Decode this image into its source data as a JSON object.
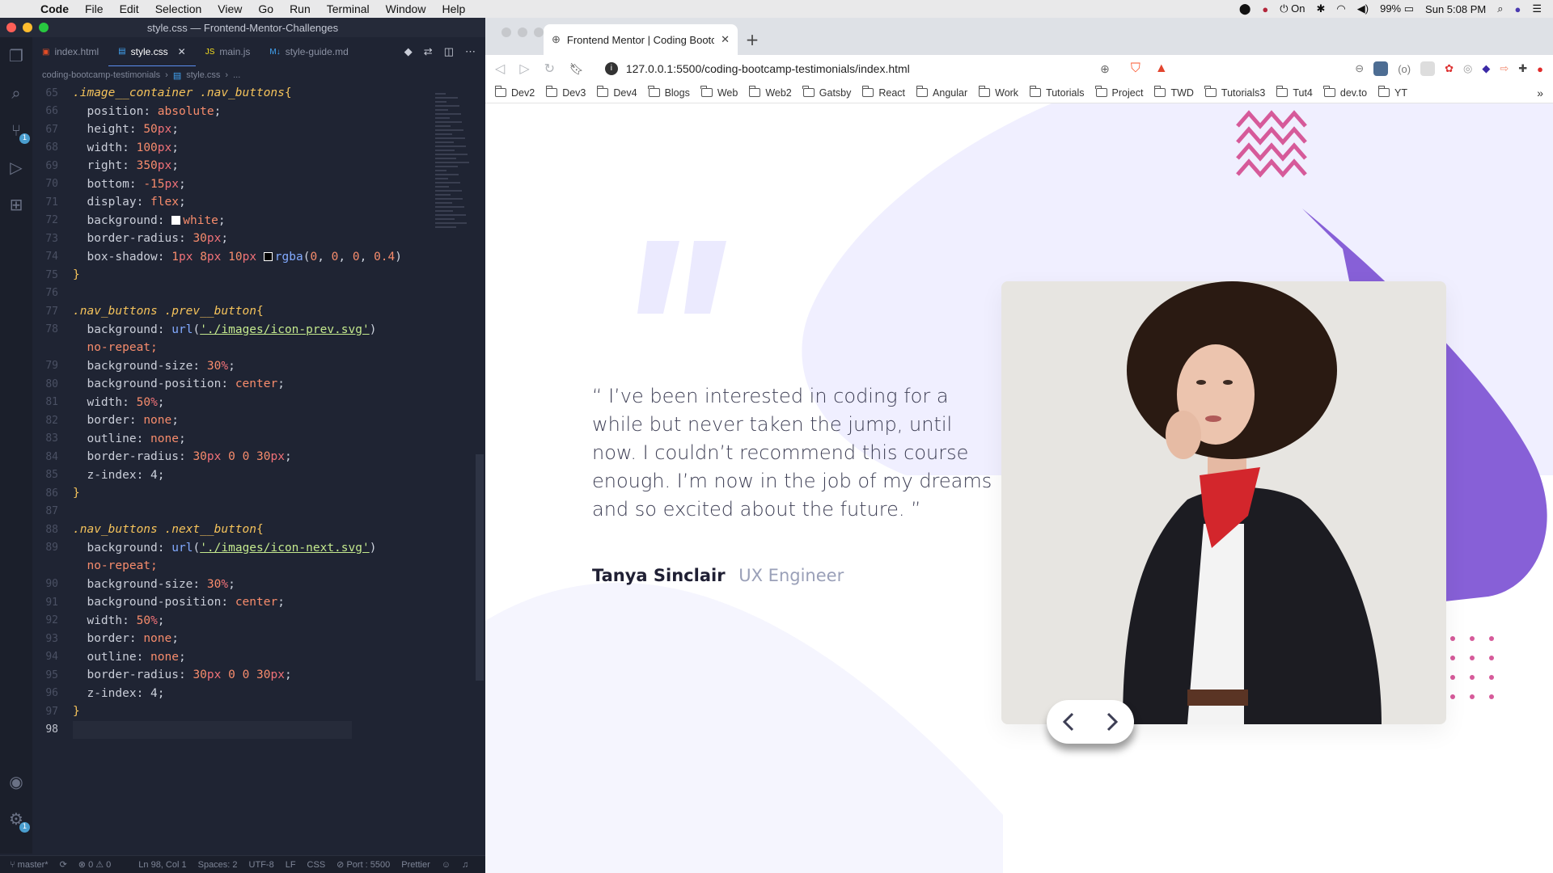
{
  "menubar": {
    "apple": "",
    "app": "Code",
    "items": [
      "File",
      "Edit",
      "Selection",
      "View",
      "Go",
      "Run",
      "Terminal",
      "Window",
      "Help"
    ],
    "status": {
      "vpn_label": "On",
      "battery": "99%",
      "clock": "Sun 5:08 PM"
    }
  },
  "vscode": {
    "title": "style.css — Frontend-Mentor-Challenges",
    "tabs": [
      {
        "label": "index.html",
        "icon": "html-file-icon",
        "active": false
      },
      {
        "label": "style.css",
        "icon": "css-file-icon",
        "active": true
      },
      {
        "label": "main.js",
        "icon": "js-file-icon",
        "active": false
      },
      {
        "label": "style-guide.md",
        "icon": "markdown-file-icon",
        "active": false
      }
    ],
    "breadcrumb": [
      "coding-bootcamp-testimonials",
      "style.css",
      "..."
    ],
    "activity_badges": {
      "source_control": "1",
      "settings": "1"
    },
    "code_lines": [
      {
        "n": "65",
        "t": ".image__container .nav_buttons{"
      },
      {
        "n": "66",
        "t": "  position: absolute;"
      },
      {
        "n": "67",
        "t": "  height: 50px;"
      },
      {
        "n": "68",
        "t": "  width: 100px;"
      },
      {
        "n": "69",
        "t": "  right: 350px;"
      },
      {
        "n": "70",
        "t": "  bottom: -15px;"
      },
      {
        "n": "71",
        "t": "  display: flex;"
      },
      {
        "n": "72",
        "t": "  background: white;"
      },
      {
        "n": "73",
        "t": "  border-radius: 30px;"
      },
      {
        "n": "74",
        "t": "  box-shadow: 1px 8px 10px rgba(0, 0, 0, 0.4)"
      },
      {
        "n": "75",
        "t": "}"
      },
      {
        "n": "76",
        "t": ""
      },
      {
        "n": "77",
        "t": ".nav_buttons .prev__button{"
      },
      {
        "n": "78",
        "t": "  background: url('./images/icon-prev.svg')"
      },
      {
        "n": "",
        "t": "  no-repeat;"
      },
      {
        "n": "79",
        "t": "  background-size: 30%;"
      },
      {
        "n": "80",
        "t": "  background-position: center;"
      },
      {
        "n": "81",
        "t": "  width: 50%;"
      },
      {
        "n": "82",
        "t": "  border: none;"
      },
      {
        "n": "83",
        "t": "  outline: none;"
      },
      {
        "n": "84",
        "t": "  border-radius: 30px 0 0 30px;"
      },
      {
        "n": "85",
        "t": "  z-index: 4;"
      },
      {
        "n": "86",
        "t": "}"
      },
      {
        "n": "87",
        "t": ""
      },
      {
        "n": "88",
        "t": ".nav_buttons .next__button{"
      },
      {
        "n": "89",
        "t": "  background: url('./images/icon-next.svg')"
      },
      {
        "n": "",
        "t": "  no-repeat;"
      },
      {
        "n": "90",
        "t": "  background-size: 30%;"
      },
      {
        "n": "91",
        "t": "  background-position: center;"
      },
      {
        "n": "92",
        "t": "  width: 50%;"
      },
      {
        "n": "93",
        "t": "  border: none;"
      },
      {
        "n": "94",
        "t": "  outline: none;"
      },
      {
        "n": "95",
        "t": "  border-radius: 30px 0 0 30px;"
      },
      {
        "n": "96",
        "t": "  z-index: 4;"
      },
      {
        "n": "97",
        "t": "}"
      },
      {
        "n": "98",
        "t": ""
      }
    ],
    "status": {
      "branch": "master*",
      "problems": "⊗ 0 ⚠ 0",
      "position": "Ln 98, Col 1",
      "spaces": "Spaces: 2",
      "encoding": "UTF-8",
      "eol": "LF",
      "language": "CSS",
      "port": "Port : 5500",
      "formatter": "Prettier"
    }
  },
  "browser": {
    "tab_title": "Frontend Mentor | Coding Bootc",
    "url": "127.0.0.1:5500/coding-bootcamp-testimonials/index.html",
    "bookmarks": [
      "Dev2",
      "Dev3",
      "Dev4",
      "Blogs",
      "Web",
      "Web2",
      "Gatsby",
      "React",
      "Angular",
      "Work",
      "Tutorials",
      "Project",
      "TWD",
      "Tutorials3",
      "Tut4",
      "dev.to",
      "YT"
    ],
    "bookmarks_more": "»"
  },
  "testimonial": {
    "quote": "“ I’ve been interested in coding for a while but never taken the jump, until now. I couldn’t recommend this course enough. I’m now in the job of my dreams and so excited about the future. ”",
    "name": "Tanya Sinclair",
    "role": "UX Engineer"
  },
  "colors": {
    "accent_purple": "#7b5cd6",
    "pattern_pink": "#d65a9a",
    "curve_bg": "#f0efff",
    "quote_mark": "#ebeafe"
  }
}
